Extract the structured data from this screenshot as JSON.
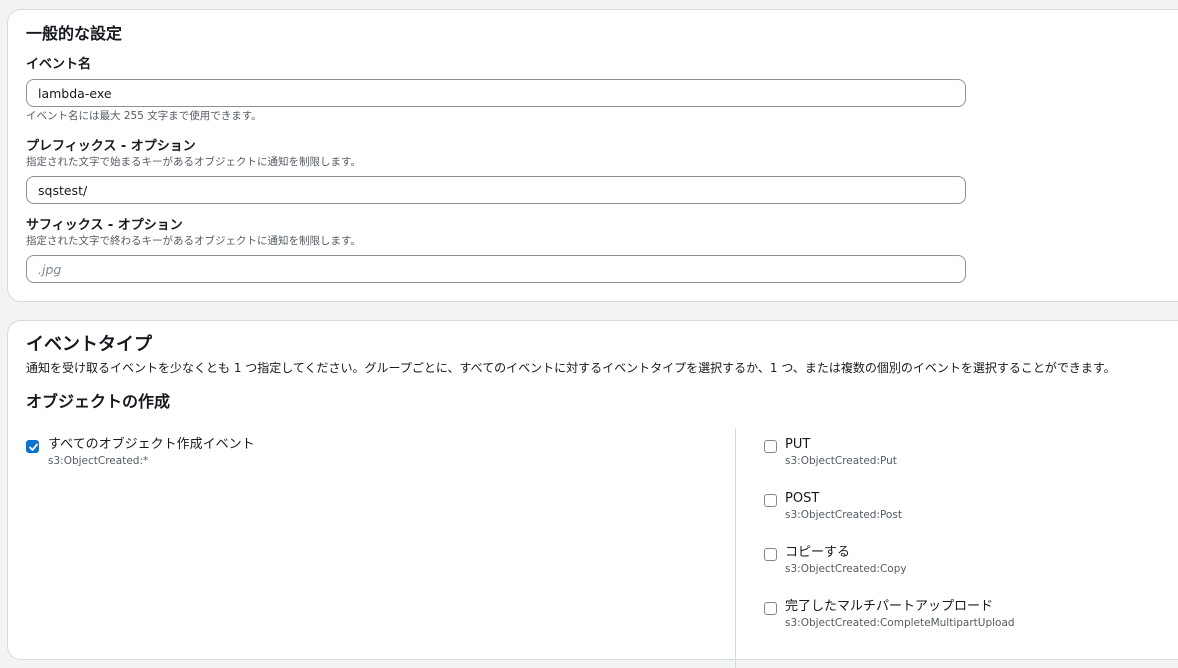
{
  "general": {
    "title": "一般的な設定",
    "event_name": {
      "label": "イベント名",
      "value": "lambda-exe",
      "hint": "イベント名には最大 255 文字まで使用できます。"
    },
    "prefix": {
      "label": "プレフィックス - オプション",
      "desc": "指定された文字で始まるキーがあるオブジェクトに通知を制限します。",
      "value": "sqstest/"
    },
    "suffix": {
      "label": "サフィックス - オプション",
      "desc": "指定された文字で終わるキーがあるオブジェクトに通知を制限します。",
      "placeholder": ".jpg"
    }
  },
  "event_types": {
    "title": "イベントタイプ",
    "desc": "通知を受け取るイベントを少なくとも 1 つ指定してください。グループごとに、すべてのイベントに対するイベントタイプを選択するか、1 つ、または複数の個別のイベントを選択することができます。",
    "group_title": "オブジェクトの作成",
    "all_option": {
      "label": "すべてのオブジェクト作成イベント",
      "sub": "s3:ObjectCreated:*",
      "checked": true
    },
    "options": [
      {
        "label": "PUT",
        "sub": "s3:ObjectCreated:Put",
        "checked": false
      },
      {
        "label": "POST",
        "sub": "s3:ObjectCreated:Post",
        "checked": false
      },
      {
        "label": "コピーする",
        "sub": "s3:ObjectCreated:Copy",
        "checked": false
      },
      {
        "label": "完了したマルチパートアップロード",
        "sub": "s3:ObjectCreated:CompleteMultipartUpload",
        "checked": false
      }
    ]
  },
  "colors": {
    "accent": "#0972d3",
    "text": "#16191f",
    "secondary_text": "#545b64",
    "border": "#8d9096"
  }
}
